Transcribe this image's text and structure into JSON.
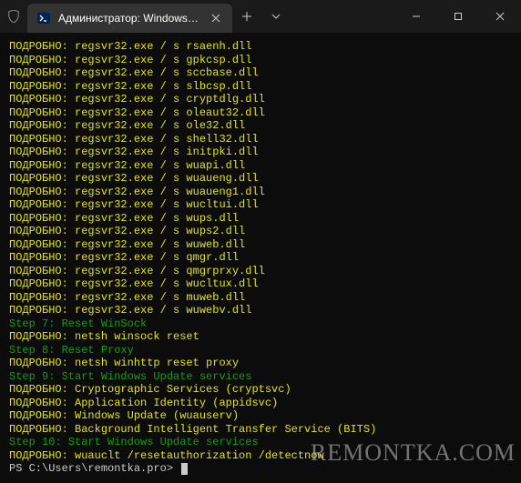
{
  "titlebar": {
    "tab_title": "Администратор: Windows Po…",
    "newtab_label": "+",
    "dropdown_label": "⌄"
  },
  "lines": [
    {
      "cls": "yellow",
      "text": "ПОДРОБНО: regsvr32.exe / s rsaenh.dll"
    },
    {
      "cls": "yellow",
      "text": "ПОДРОБНО: regsvr32.exe / s gpkcsp.dll"
    },
    {
      "cls": "yellow",
      "text": "ПОДРОБНО: regsvr32.exe / s sccbase.dll"
    },
    {
      "cls": "yellow",
      "text": "ПОДРОБНО: regsvr32.exe / s slbcsp.dll"
    },
    {
      "cls": "yellow",
      "text": "ПОДРОБНО: regsvr32.exe / s cryptdlg.dll"
    },
    {
      "cls": "yellow",
      "text": "ПОДРОБНО: regsvr32.exe / s oleaut32.dll"
    },
    {
      "cls": "yellow",
      "text": "ПОДРОБНО: regsvr32.exe / s ole32.dll"
    },
    {
      "cls": "yellow",
      "text": "ПОДРОБНО: regsvr32.exe / s shell32.dll"
    },
    {
      "cls": "yellow",
      "text": "ПОДРОБНО: regsvr32.exe / s initpki.dll"
    },
    {
      "cls": "yellow",
      "text": "ПОДРОБНО: regsvr32.exe / s wuapi.dll"
    },
    {
      "cls": "yellow",
      "text": "ПОДРОБНО: regsvr32.exe / s wuaueng.dll"
    },
    {
      "cls": "yellow",
      "text": "ПОДРОБНО: regsvr32.exe / s wuaueng1.dll"
    },
    {
      "cls": "yellow",
      "text": "ПОДРОБНО: regsvr32.exe / s wucltui.dll"
    },
    {
      "cls": "yellow",
      "text": "ПОДРОБНО: regsvr32.exe / s wups.dll"
    },
    {
      "cls": "yellow",
      "text": "ПОДРОБНО: regsvr32.exe / s wups2.dll"
    },
    {
      "cls": "yellow",
      "text": "ПОДРОБНО: regsvr32.exe / s wuweb.dll"
    },
    {
      "cls": "yellow",
      "text": "ПОДРОБНО: regsvr32.exe / s qmgr.dll"
    },
    {
      "cls": "yellow",
      "text": "ПОДРОБНО: regsvr32.exe / s qmgrprxy.dll"
    },
    {
      "cls": "yellow",
      "text": "ПОДРОБНО: regsvr32.exe / s wucltux.dll"
    },
    {
      "cls": "yellow",
      "text": "ПОДРОБНО: regsvr32.exe / s muweb.dll"
    },
    {
      "cls": "yellow",
      "text": "ПОДРОБНО: regsvr32.exe / s wuwebv.dll"
    },
    {
      "cls": "green",
      "text": "Step 7: Reset WinSock"
    },
    {
      "cls": "yellow",
      "text": "ПОДРОБНО: netsh winsock reset"
    },
    {
      "cls": "green",
      "text": "Step 8: Reset Proxy"
    },
    {
      "cls": "yellow",
      "text": "ПОДРОБНО: netsh winhttp reset proxy"
    },
    {
      "cls": "green",
      "text": "Step 9: Start Windows Update services"
    },
    {
      "cls": "yellow",
      "text": "ПОДРОБНО: Cryptographic Services (cryptsvc)"
    },
    {
      "cls": "yellow",
      "text": "ПОДРОБНО: Application Identity (appidsvc)"
    },
    {
      "cls": "yellow",
      "text": "ПОДРОБНО: Windows Update (wuauserv)"
    },
    {
      "cls": "yellow",
      "text": "ПОДРОБНО: Background Intelligent Transfer Service (BITS)"
    },
    {
      "cls": "green",
      "text": "Step 10: Start Windows Update services"
    },
    {
      "cls": "yellow",
      "text": "ПОДРОБНО: wuauclt /resetauthorization /detectnow"
    }
  ],
  "prompt": "PS C:\\Users\\remontka.pro> ",
  "watermark": "REMONTKA.COM"
}
